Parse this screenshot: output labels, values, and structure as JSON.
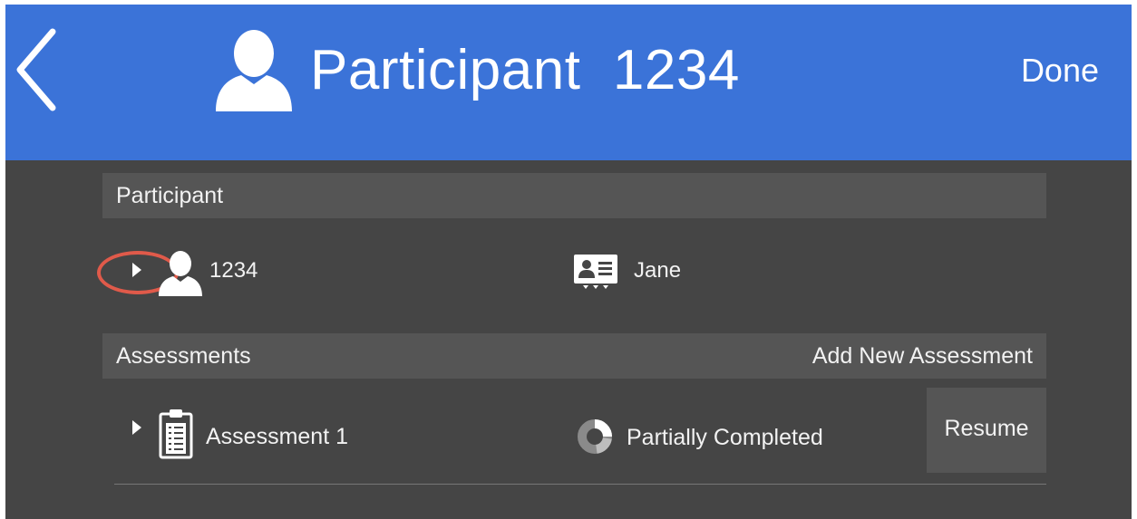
{
  "header": {
    "title_label": "Participant",
    "title_id": "1234",
    "done_label": "Done",
    "color": "#3b73d8"
  },
  "participant_section": {
    "title": "Participant",
    "id": "1234",
    "name": "Jane"
  },
  "assessments_section": {
    "title": "Assessments",
    "add_label": "Add New Assessment",
    "items": [
      {
        "name": "Assessment 1",
        "status": "Partially Completed",
        "action_label": "Resume"
      }
    ]
  },
  "icons": {
    "back": "chevron-left-icon",
    "title": "person-icon",
    "expand": "triangle-right-icon",
    "participant": "person-icon",
    "name": "id-card-icon",
    "assessment": "clipboard-icon",
    "status": "progress-ring-icon"
  },
  "highlight_color": "#e05a4a"
}
